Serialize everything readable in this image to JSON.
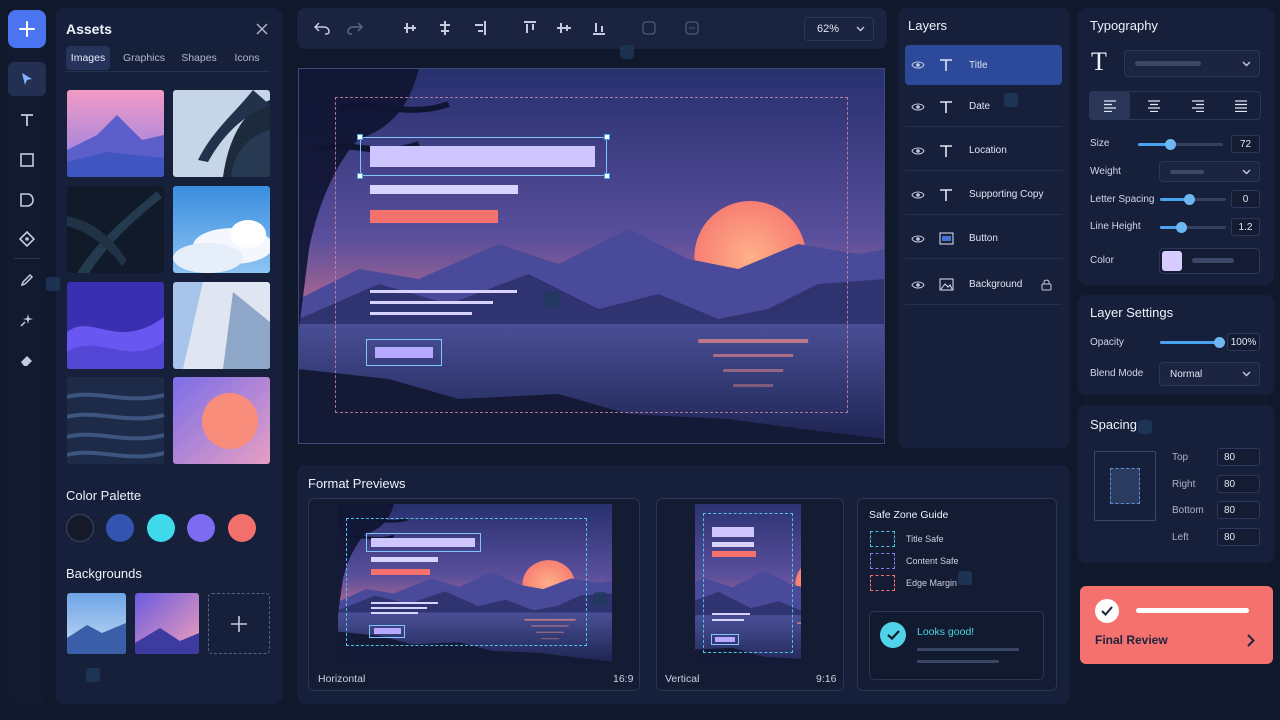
{
  "assets": {
    "title": "Assets",
    "tabs": [
      "Images",
      "Graphics",
      "Shapes",
      "Icons"
    ],
    "color_palette_title": "Color Palette",
    "palette": [
      "#141a2a",
      "#3452b0",
      "#3fd9ec",
      "#7d6cf2",
      "#f26f6b"
    ],
    "backgrounds_title": "Backgrounds"
  },
  "topbar": {
    "zoom": "62%"
  },
  "layers": {
    "title": "Layers",
    "items": [
      "Title",
      "Date",
      "Location",
      "Supporting Copy",
      "Button",
      "Background"
    ]
  },
  "typography": {
    "title": "Typography",
    "size_label": "Size",
    "size_value": "72",
    "size_level": 0.38,
    "weight_label": "Weight",
    "letter_spacing_label": "Letter Spacing",
    "letter_spacing_value": "0",
    "letter_spacing_level": 0.44,
    "line_height_label": "Line Height",
    "line_height_value": "1.2",
    "line_height_level": 0.32,
    "color_label": "Color",
    "color_value": "#d6ccff"
  },
  "layer_settings": {
    "title": "Layer Settings",
    "opacity_label": "Opacity",
    "opacity_value": "100%",
    "opacity_level": 1.0,
    "blend_label": "Blend Mode",
    "blend_value": "Normal"
  },
  "spacing": {
    "title": "Spacing",
    "top_label": "Top",
    "top_value": "80",
    "right_label": "Right",
    "right_value": "80",
    "bottom_label": "Bottom",
    "bottom_value": "80",
    "left_label": "Left",
    "left_value": "80"
  },
  "final_review": {
    "label": "Final Review",
    "color": "#f4716d"
  },
  "formats": {
    "title": "Format Previews",
    "horizontal_label": "Horizontal",
    "horizontal_ratio": "16:9",
    "vertical_label": "Vertical",
    "vertical_ratio": "9:16",
    "guide_title": "Safe Zone Guide",
    "guide_items": [
      "Title Safe",
      "Content Safe",
      "Edge Margin"
    ],
    "looks_good": "Looks good!"
  },
  "colors": {
    "accent": "#4b74f0",
    "selection": "#7fc4ff",
    "coral": "#f4716d",
    "lavender": "#cfc6ff"
  }
}
